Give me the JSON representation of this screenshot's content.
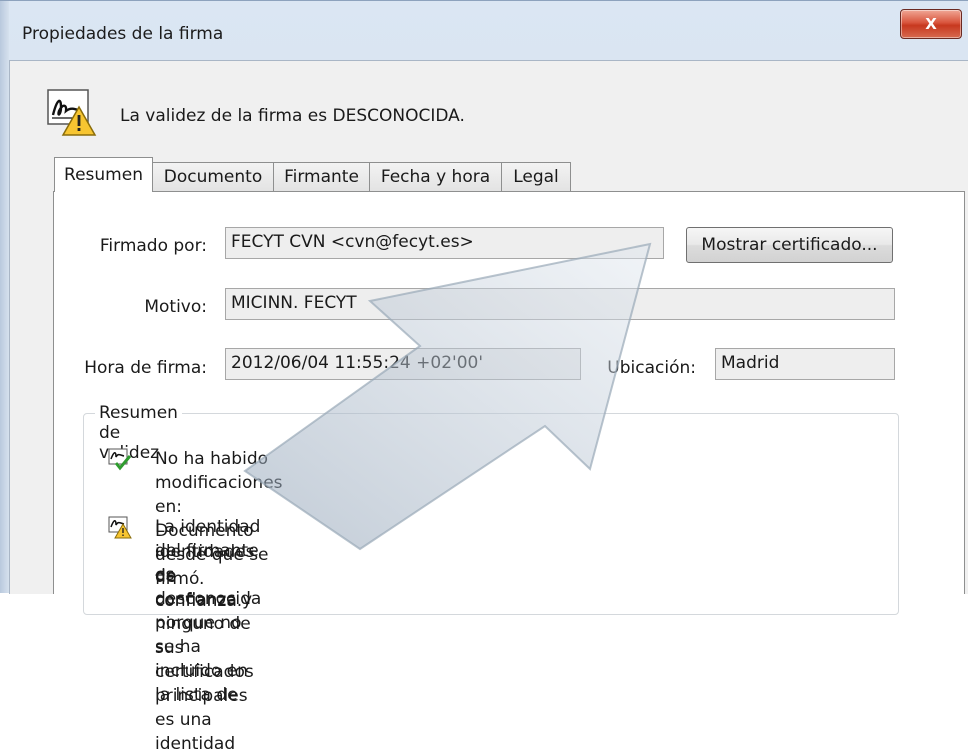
{
  "window": {
    "title": "Propiedades de la firma",
    "close_label": "X"
  },
  "status": {
    "message": "La validez de la firma es DESCONOCIDA."
  },
  "tabs": [
    {
      "label": "Resumen",
      "active": true
    },
    {
      "label": "Documento",
      "active": false
    },
    {
      "label": "Firmante",
      "active": false
    },
    {
      "label": "Fecha y hora",
      "active": false
    },
    {
      "label": "Legal",
      "active": false
    }
  ],
  "summary": {
    "signed_by_label": "Firmado por:",
    "signed_by_value": "FECYT CVN <cvn@fecyt.es>",
    "show_certificate_label": "Mostrar certificado...",
    "reason_label": "Motivo:",
    "reason_value": "MICINN. FECYT",
    "sign_time_label": "Hora de firma:",
    "sign_time_value": "2012/06/04 11:55:24 +02'00'",
    "location_label": "Ubicación:",
    "location_value": "Madrid"
  },
  "validity": {
    "legend": "Resumen de validez",
    "items": [
      {
        "icon": "signature-valid-check-icon",
        "text": "No ha habido modificaciones en: Documento desde que se firmó."
      },
      {
        "icon": "signature-warning-icon",
        "lines": [
          "La identidad del firmante es desconocida porque no se ha incluido en la lista de",
          "identidades de confianza y ninguno de sus certificados principales es una identidad",
          "de confianza."
        ]
      }
    ]
  },
  "overlay": {
    "icon": "pointer-arrow-overlay"
  }
}
